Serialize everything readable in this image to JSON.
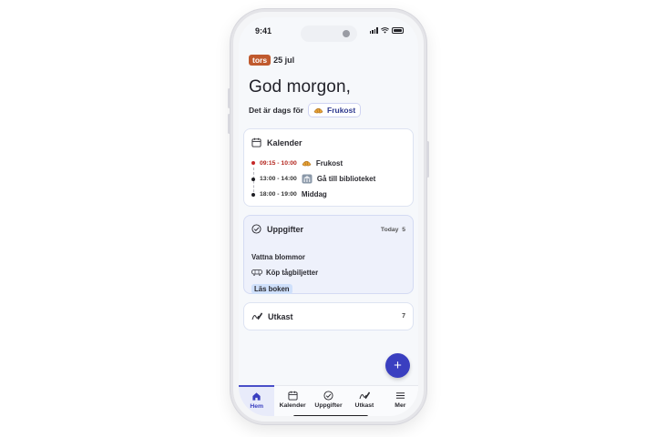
{
  "status": {
    "time": "9:41"
  },
  "header": {
    "day": "tors",
    "date": "25 jul",
    "greeting": "God morgon,",
    "meal_prefix": "Det är dags för",
    "meal_label": "Frukost"
  },
  "calendar": {
    "title": "Kalender",
    "events": [
      {
        "time": "09:15 - 10:00",
        "name": "Frukost",
        "current": true
      },
      {
        "time": "13:00 - 14:00",
        "name": "Gå till biblioteket",
        "current": false
      },
      {
        "time": "18:00 - 19:00",
        "name": "Middag",
        "current": false
      }
    ]
  },
  "tasks": {
    "title": "Uppgifter",
    "today_label": "Today",
    "today_count": "5",
    "items": [
      "Vattna blommor",
      "Köp tågbiljetter",
      "Läs boken"
    ]
  },
  "drafts": {
    "title": "Utkast",
    "count": "7"
  },
  "fab": {
    "label": "+"
  },
  "tabs": [
    "Hem",
    "Kalender",
    "Uppgifter",
    "Utkast",
    "Mer"
  ],
  "colors": {
    "accent": "#3a3fc0",
    "day_badge": "#c05a2e",
    "current_event": "#c62828",
    "highlight": "#cfe0fb"
  }
}
